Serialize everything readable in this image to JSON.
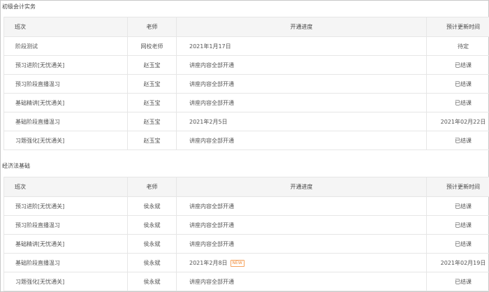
{
  "colors": {
    "border": "#e6e6e6",
    "header_bg": "#f5f5f5",
    "new_badge": "#f08c3a"
  },
  "sections": [
    {
      "title": "初级会计实务",
      "headers": {
        "name": "班次",
        "teacher": "老师",
        "progress": "开通进度",
        "time": "预计更新时间"
      },
      "rows": [
        {
          "name": "阶段测试",
          "teacher": "网校老师",
          "progress": "2021年1月17日",
          "time": "待定"
        },
        {
          "name": "预习进阶[无忧通关]",
          "teacher": "赵玉宝",
          "progress": "讲座内容全部开通",
          "time": "已结课"
        },
        {
          "name": "预习阶段直播温习",
          "teacher": "赵玉宝",
          "progress": "讲座内容全部开通",
          "time": "已结课"
        },
        {
          "name": "基础精讲[无忧通关]",
          "teacher": "赵玉宝",
          "progress": "讲座内容全部开通",
          "time": "已结课"
        },
        {
          "name": "基础阶段直播温习",
          "teacher": "赵玉宝",
          "progress": "2021年2月5日",
          "time": "2021年02月22日"
        },
        {
          "name": "习题强化[无忧通关]",
          "teacher": "赵玉宝",
          "progress": "讲座内容全部开通",
          "time": "已结课"
        }
      ]
    },
    {
      "title": "经济法基础",
      "headers": {
        "name": "班次",
        "teacher": "老师",
        "progress": "开通进度",
        "time": "预计更新时间"
      },
      "rows": [
        {
          "name": "预习进阶[无忧通关]",
          "teacher": "侯永斌",
          "progress": "讲座内容全部开通",
          "time": "已结课"
        },
        {
          "name": "预习阶段直播温习",
          "teacher": "侯永斌",
          "progress": "讲座内容全部开通",
          "time": "已结课"
        },
        {
          "name": "基础精讲[无忧通关]",
          "teacher": "侯永斌",
          "progress": "讲座内容全部开通",
          "time": "已结课"
        },
        {
          "name": "基础阶段直播温习",
          "teacher": "侯永斌",
          "progress": "2021年2月8日",
          "badge": "NEW",
          "time": "2021年02月19日"
        },
        {
          "name": "习题强化[无忧通关]",
          "teacher": "侯永斌",
          "progress": "讲座内容全部开通",
          "time": "已结课"
        }
      ]
    }
  ]
}
